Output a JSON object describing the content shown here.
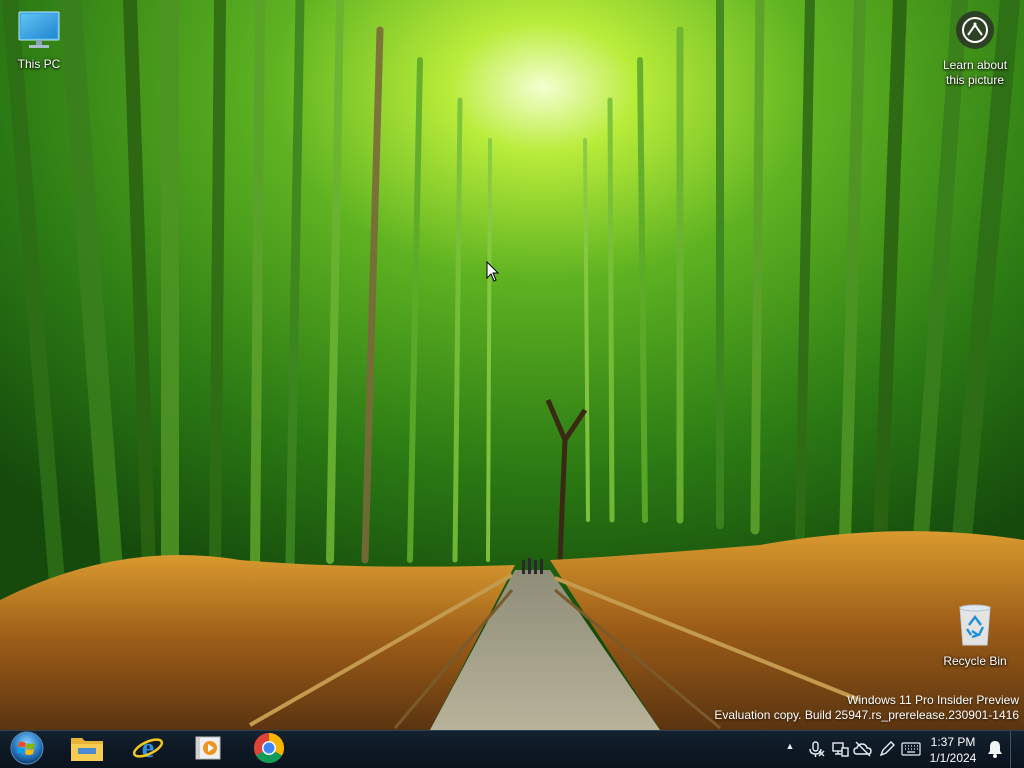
{
  "desktop": {
    "icons": [
      {
        "label": "This PC"
      },
      {
        "label": "Recycle Bin"
      }
    ],
    "learn_about": {
      "line1": "Learn about",
      "line2": "this picture"
    }
  },
  "watermark": {
    "line1": "Windows 11 Pro Insider Preview",
    "line2": "Evaluation copy. Build 25947.rs_prerelease.230901-1416"
  },
  "taskbar": {
    "start_icon": "windows-orb-icon",
    "pinned": [
      {
        "name": "file-explorer-icon"
      },
      {
        "name": "internet-explorer-icon"
      },
      {
        "name": "media-player-icon"
      },
      {
        "name": "chrome-icon"
      }
    ],
    "tray": {
      "overflow_glyph": "▲",
      "icons": [
        "mic-off-icon",
        "network-icon",
        "cloud-off-icon",
        "pen-icon",
        "keyboard-icon",
        "notification-bell-icon"
      ]
    },
    "clock": {
      "time": "1:37 PM",
      "date": "1/1/2024"
    }
  },
  "colors": {
    "taskbar": "#0c1722",
    "accent": "#1f7fd4"
  }
}
